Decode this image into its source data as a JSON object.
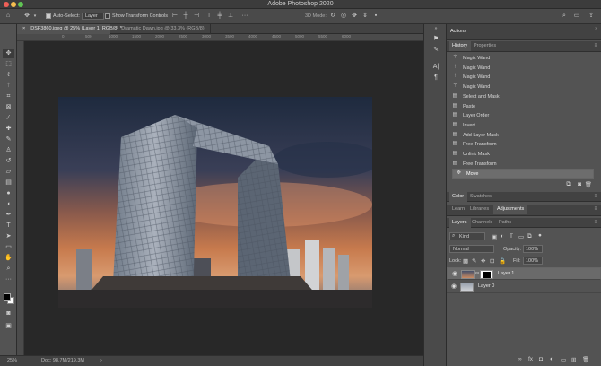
{
  "window": {
    "title": "Adobe Photoshop 2020"
  },
  "options_bar": {
    "auto_select_label": "Auto-Select:",
    "auto_select_value": "Layer",
    "transform_label": "Show Transform Controls",
    "mode_3d_label": "3D Mode:"
  },
  "document_tabs": [
    {
      "label": "_DSF3860.jpeg @ 25% (Layer 1, RGB/8) *"
    },
    {
      "label": "Dramatic Dawn.jpg @ 33.3% (RGB/8)"
    }
  ],
  "ruler": {
    "marks": [
      "0",
      "500",
      "1000",
      "1500",
      "2000",
      "2500",
      "3000",
      "3500",
      "4000",
      "4500",
      "5000",
      "5500",
      "6000"
    ]
  },
  "status_bar": {
    "zoom": "25%",
    "doc_info": "Doc: 98.7M/219.3M"
  },
  "actions_panel": {
    "title": "Actions"
  },
  "history_panel": {
    "tabs": [
      "History",
      "Properties"
    ],
    "items": [
      {
        "label": "Magic Wand",
        "icon": "magic-wand-icon"
      },
      {
        "label": "Magic Wand",
        "icon": "magic-wand-icon"
      },
      {
        "label": "Magic Wand",
        "icon": "magic-wand-icon"
      },
      {
        "label": "Magic Wand",
        "icon": "magic-wand-icon"
      },
      {
        "label": "Select and Mask",
        "icon": "history-state-icon"
      },
      {
        "label": "Paste",
        "icon": "history-state-icon"
      },
      {
        "label": "Layer Order",
        "icon": "history-state-icon"
      },
      {
        "label": "Invert",
        "icon": "history-state-icon"
      },
      {
        "label": "Add Layer Mask",
        "icon": "history-state-icon"
      },
      {
        "label": "Free Transform",
        "icon": "history-state-icon"
      },
      {
        "label": "Unlink Mask",
        "icon": "history-state-icon"
      },
      {
        "label": "Free Transform",
        "icon": "history-state-icon"
      },
      {
        "label": "Move",
        "icon": "move-icon"
      }
    ],
    "selected_index": 12
  },
  "color_panel": {
    "tabs": [
      "Color",
      "Swatches"
    ]
  },
  "adjust_panel": {
    "tabs": [
      "Learn",
      "Libraries",
      "Adjustments"
    ]
  },
  "layers_panel": {
    "tabs": [
      "Layers",
      "Channels",
      "Paths"
    ],
    "filter_value": "Kind",
    "blend_mode": "Normal",
    "opacity_label": "Opacity:",
    "opacity_value": "100%",
    "lock_label": "Lock:",
    "fill_label": "Fill:",
    "fill_value": "100%",
    "layers": [
      {
        "name": "Layer 1",
        "selected": true
      },
      {
        "name": "Layer 0",
        "selected": false
      }
    ],
    "footer_fx": "fx"
  },
  "colors": {
    "accent": "#1473e6",
    "panel": "#535353",
    "dark": "#282828"
  }
}
